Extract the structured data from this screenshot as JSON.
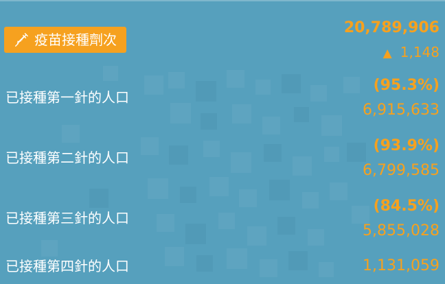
{
  "header": {
    "badge_label": "疫苗接種劑次",
    "badge_icon": "syringe-icon",
    "total": "20,789,906",
    "delta_arrow": "▲",
    "delta": "1,148"
  },
  "rows": [
    {
      "label": "已接種第一針的人口",
      "percent": "(95.3%)",
      "count": "6,915,633"
    },
    {
      "label": "已接種第二針的人口",
      "percent": "(93.9%)",
      "count": "6,799,585"
    },
    {
      "label": "已接種第三針的人口",
      "percent": "(84.5%)",
      "count": "5,855,028"
    },
    {
      "label": "已接種第四針的人口",
      "count": "1,131,059"
    }
  ],
  "colors": {
    "background": "#56a0bd",
    "accent": "#f6a11f",
    "text": "#ffffff"
  }
}
